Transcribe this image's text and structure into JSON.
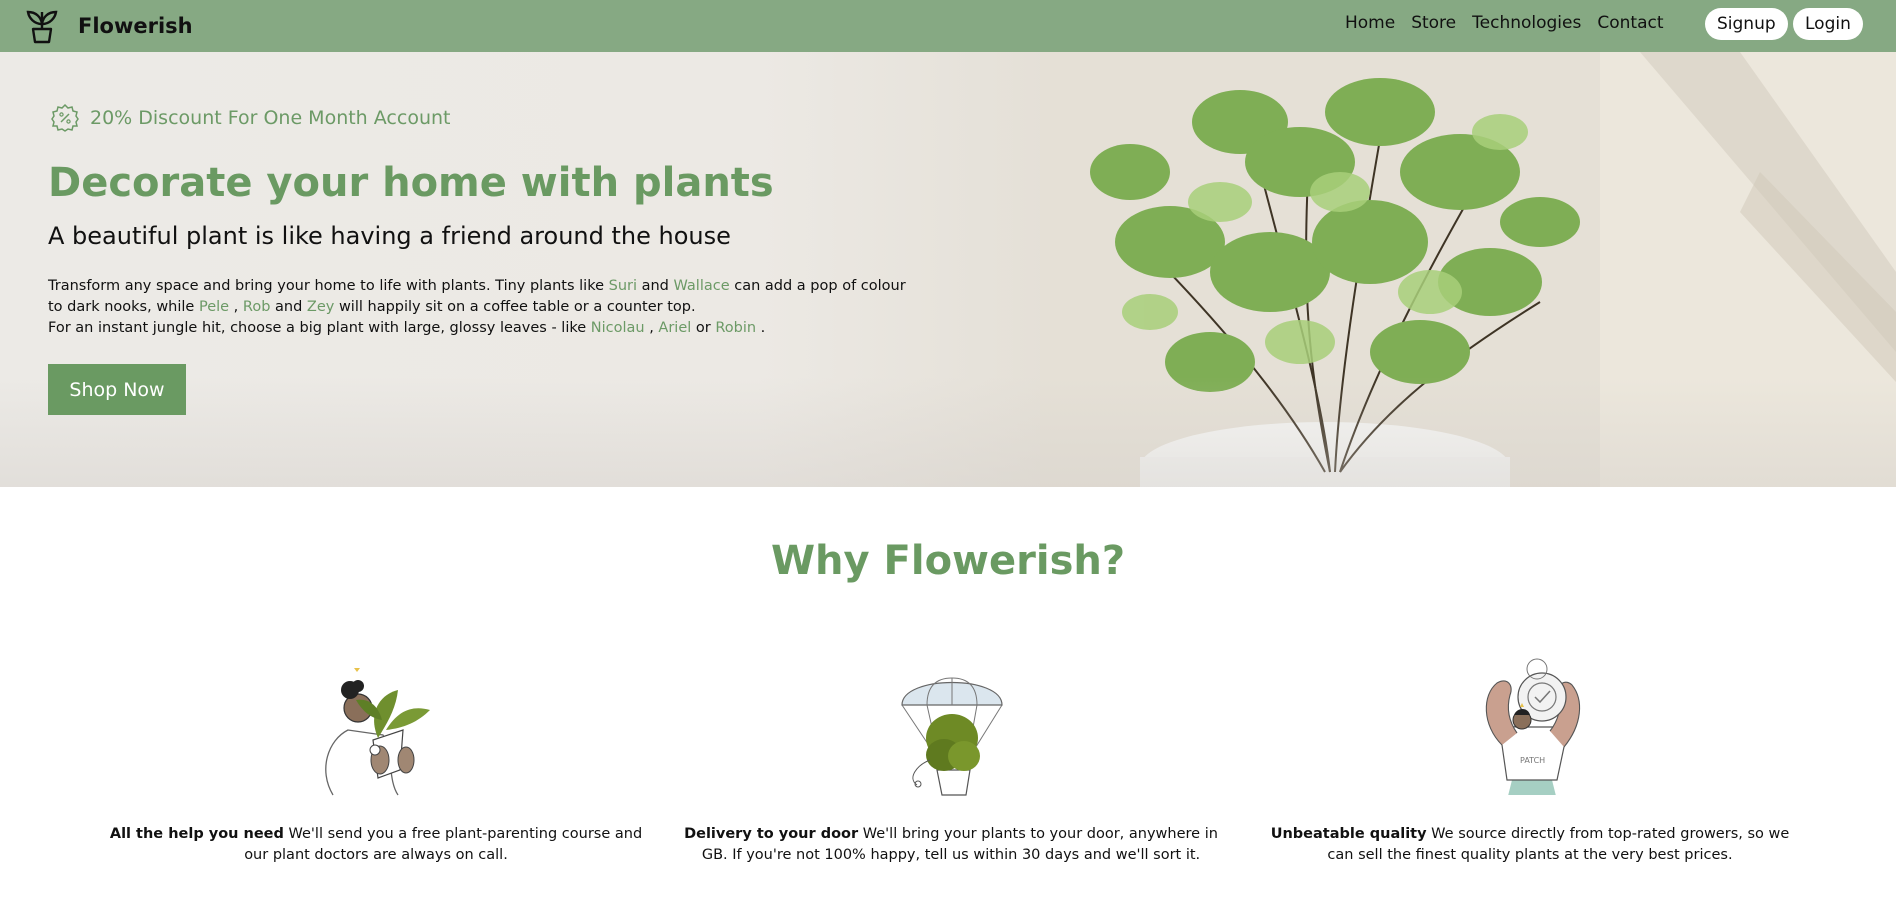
{
  "nav": {
    "brand": "Flowerish",
    "links": [
      "Home",
      "Store",
      "Technologies",
      "Contact"
    ],
    "signup": "Signup",
    "login": "Login"
  },
  "hero": {
    "promo": "20% Discount For One Month Account",
    "title": "Decorate your home with plants",
    "subtitle": "A beautiful plant is like having a friend around the house",
    "text": {
      "p1a": "Transform any space and bring your home to life with plants. Tiny plants like ",
      "suri": "Suri",
      "and1": " and ",
      "wallace": "Wallace",
      "p1b": " can add a pop of colour to dark nooks, while ",
      "pele": "Pele",
      "comma1": " , ",
      "rob": "Rob",
      "and2": " and ",
      "zey": "Zey",
      "p1c": " will happily sit on a coffee table or a counter top.",
      "p2a": "For an instant jungle hit, choose a big plant with large, glossy leaves - like ",
      "nicolau": "Nicolau",
      "comma2": " , ",
      "ariel": "Ariel",
      "or": " or ",
      "robin": "Robin",
      "end": " ."
    },
    "cta": "Shop Now"
  },
  "why": {
    "title": "Why Flowerish?",
    "features": [
      {
        "icon": "person-holding-plant-icon",
        "bold": "All the help you need",
        "text": " We'll send you a free plant-parenting course and our plant doctors are always on call."
      },
      {
        "icon": "plant-parachute-icon",
        "bold": "Delivery to your door",
        "text": " We'll bring your plants to your door, anywhere in GB. If you're not 100% happy, tell us within 30 days and we'll sort it."
      },
      {
        "icon": "quality-badge-person-icon",
        "bold": "Unbeatable quality",
        "text": " We source directly from top-rated growers, so we can sell the finest quality plants at the very best prices."
      }
    ]
  },
  "colors": {
    "brand_green": "#6a9a62",
    "nav_bg": "#86a983"
  }
}
